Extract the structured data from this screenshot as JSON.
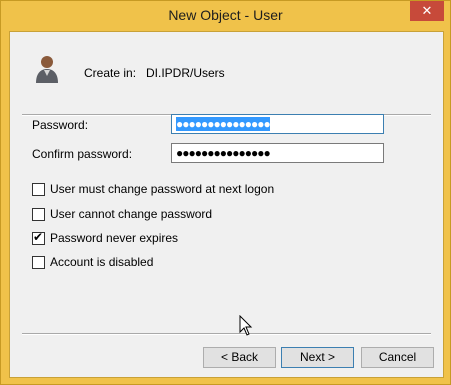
{
  "window": {
    "title": "New Object - User",
    "close_label": "✕"
  },
  "header": {
    "create_in_label": "Create in:",
    "create_in_value": "DI.IPDR/Users"
  },
  "fields": {
    "password_label": "Password:",
    "password_value": "●●●●●●●●●●●●●●●",
    "confirm_label": "Confirm password:",
    "confirm_value": "●●●●●●●●●●●●●●●"
  },
  "options": [
    {
      "label": "User must change password at next logon",
      "checked": false
    },
    {
      "label": "User cannot change password",
      "checked": false
    },
    {
      "label": "Password never expires",
      "checked": true
    },
    {
      "label": "Account is disabled",
      "checked": false
    }
  ],
  "buttons": {
    "back": "< Back",
    "next": "Next >",
    "cancel": "Cancel"
  },
  "checkmark": "✔",
  "icons": {
    "avatar": "user-avatar-icon",
    "cursor": "mouse-pointer-icon"
  },
  "colors": {
    "title_bar": "#f0c24a",
    "selection": "#3399ff",
    "close_button": "#c74a3a"
  }
}
